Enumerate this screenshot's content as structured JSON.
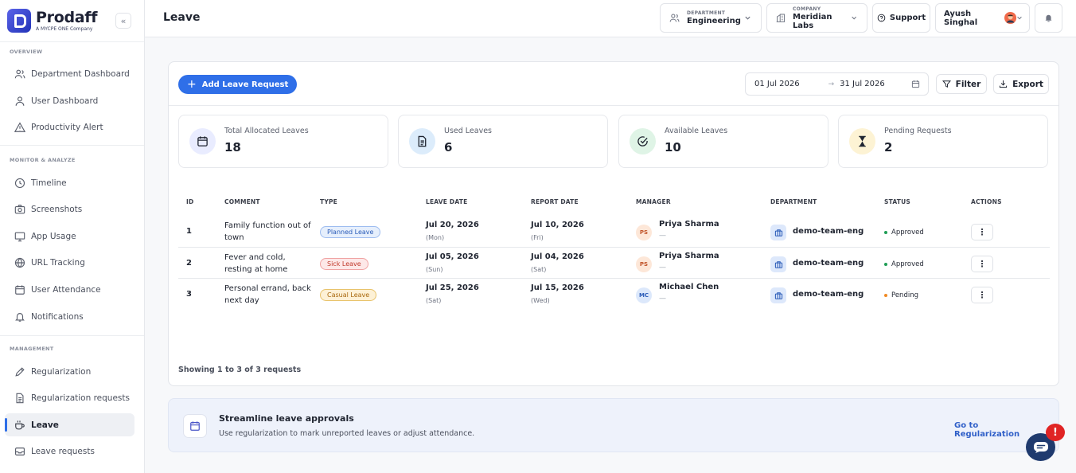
{
  "brand": {
    "name": "Prodaff",
    "tagline": "A MYCPE ONE Company",
    "collapse_icon": "«"
  },
  "sidebar": {
    "sections": [
      {
        "title": "OVERVIEW"
      },
      {
        "title": "MONITOR & ANALYZE"
      },
      {
        "title": "MANAGEMENT"
      }
    ],
    "items": [
      {
        "label": "Department Dashboard",
        "icon": "users-icon"
      },
      {
        "label": "User Dashboard",
        "icon": "user-icon"
      },
      {
        "label": "Productivity Alert",
        "icon": "alert-triangle-icon"
      },
      {
        "label": "Timeline",
        "icon": "clock-icon"
      },
      {
        "label": "Screenshots",
        "icon": "camera-icon"
      },
      {
        "label": "App Usage",
        "icon": "monitor-icon"
      },
      {
        "label": "URL Tracking",
        "icon": "globe-icon"
      },
      {
        "label": "User Attendance",
        "icon": "calendar-icon"
      },
      {
        "label": "Notifications",
        "icon": "bell-icon"
      },
      {
        "label": "Regularization",
        "icon": "pen-icon"
      },
      {
        "label": "Regularization requests",
        "icon": "file-icon"
      },
      {
        "label": "Leave",
        "icon": "coffee-icon",
        "active": true
      },
      {
        "label": "Leave requests",
        "icon": "inbox-icon"
      }
    ]
  },
  "header": {
    "title": "Leave",
    "department": {
      "caption": "DEPARTMENT",
      "value": "Engineering"
    },
    "company": {
      "caption": "COMPANY",
      "value": "Meridian Labs"
    },
    "support_label": "Support",
    "user_name": "Ayush Singhal"
  },
  "toolbar": {
    "add_label": "Add Leave Request",
    "date_from": "01 Jul 2026",
    "date_arrow": "→",
    "date_to": "31 Jul 2026",
    "filter_label": "Filter",
    "export_label": "Export"
  },
  "stats": [
    {
      "label": "Total Allocated Leaves",
      "value": "18",
      "icon": "calendar-icon",
      "bg": "#e9ecff",
      "color": "#3a3f8f"
    },
    {
      "label": "Used Leaves",
      "value": "6",
      "icon": "document-icon",
      "bg": "#dcecfb",
      "color": "#1f2a44"
    },
    {
      "label": "Available Leaves",
      "value": "10",
      "icon": "check-circle-icon",
      "bg": "#dff4e6",
      "color": "#1f2a44"
    },
    {
      "label": "Pending Requests",
      "value": "2",
      "icon": "hourglass-icon",
      "bg": "#fdf3d4",
      "color": "#1f2a44"
    }
  ],
  "table": {
    "columns": [
      "ID",
      "COMMENT",
      "TYPE",
      "LEAVE DATE",
      "REPORT DATE",
      "MANAGER",
      "DEPARTMENT",
      "STATUS",
      "ACTIONS"
    ],
    "rows": [
      {
        "id": "1",
        "comment": "Family function out of town",
        "type": "Planned Leave",
        "type_bg": "#e6effc",
        "type_border": "#9dbcf0",
        "type_color": "#2a5bb8",
        "leave_date": "Jul 20, 2026",
        "leave_day": "(Mon)",
        "report_date": "Jul 10, 2026",
        "report_day": "(Fri)",
        "manager_initials": "PS",
        "manager": "Priya Sharma",
        "manager_sub": "—",
        "avatar_bg": "#fde7d8",
        "avatar_color": "#c0542a",
        "department": "demo-team-eng",
        "status": "Approved",
        "status_color": "#1f9d55",
        "action": "⋮"
      },
      {
        "id": "2",
        "comment": "Fever and cold, resting at home",
        "type": "Sick Leave",
        "type_bg": "#fde8e8",
        "type_border": "#f0a3a3",
        "type_color": "#c0392b",
        "leave_date": "Jul 05, 2026",
        "leave_day": "(Sun)",
        "report_date": "Jul 04, 2026",
        "report_day": "(Sat)",
        "manager_initials": "PS",
        "manager": "Priya Sharma",
        "manager_sub": "—",
        "avatar_bg": "#fde7d8",
        "avatar_color": "#c0542a",
        "department": "demo-team-eng",
        "status": "Approved",
        "status_color": "#1f9d55",
        "action": "⋮"
      },
      {
        "id": "3",
        "comment": "Personal errand, back next day",
        "type": "Casual Leave",
        "type_bg": "#fdf1d6",
        "type_border": "#e8c36b",
        "type_color": "#a8660c",
        "leave_date": "Jul 25, 2026",
        "leave_day": "(Sat)",
        "report_date": "Jul 15, 2026",
        "report_day": "(Wed)",
        "manager_initials": "MC",
        "manager": "Michael Chen",
        "manager_sub": "—",
        "avatar_bg": "#dce8fb",
        "avatar_color": "#2a5bb8",
        "department": "demo-team-eng",
        "status": "Pending",
        "status_color": "#f08a24",
        "action": "⋮"
      }
    ],
    "footer": "Showing 1 to 3 of 3 requests"
  },
  "banner": {
    "title": "Streamline leave approvals",
    "subtitle": "Use regularization to mark unreported leaves or adjust attendance.",
    "link": "Go to Regularization"
  },
  "chat": {
    "badge": "!"
  },
  "colors": {
    "accent": "#2f6fe8",
    "sidebar_active": "#eef0f4"
  }
}
